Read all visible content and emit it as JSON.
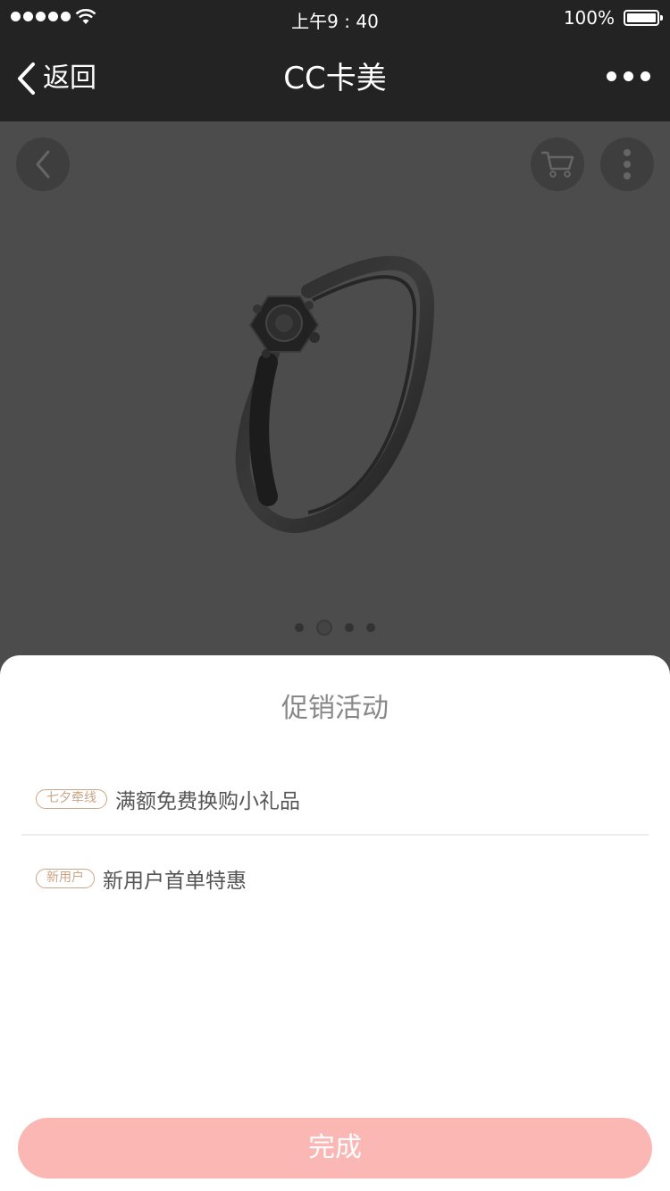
{
  "status_bar": {
    "time": "上午9 : 40",
    "battery": "100%"
  },
  "nav": {
    "back_label": "返回",
    "title": "CC卡美"
  },
  "hero": {
    "image_desc_icon": "ring-image",
    "page_count": 4,
    "active_page": 2
  },
  "sheet": {
    "title": "促销活动",
    "promotions": [
      {
        "tag": "七夕牵线",
        "text": "满额免费换购小礼品"
      },
      {
        "tag": "新用户",
        "text": "新用户首单特惠"
      }
    ],
    "done_label": "完成"
  },
  "colors": {
    "nav_bg": "#232323",
    "tag_accent": "#c9a486",
    "done_button": "#fbb7b4"
  }
}
